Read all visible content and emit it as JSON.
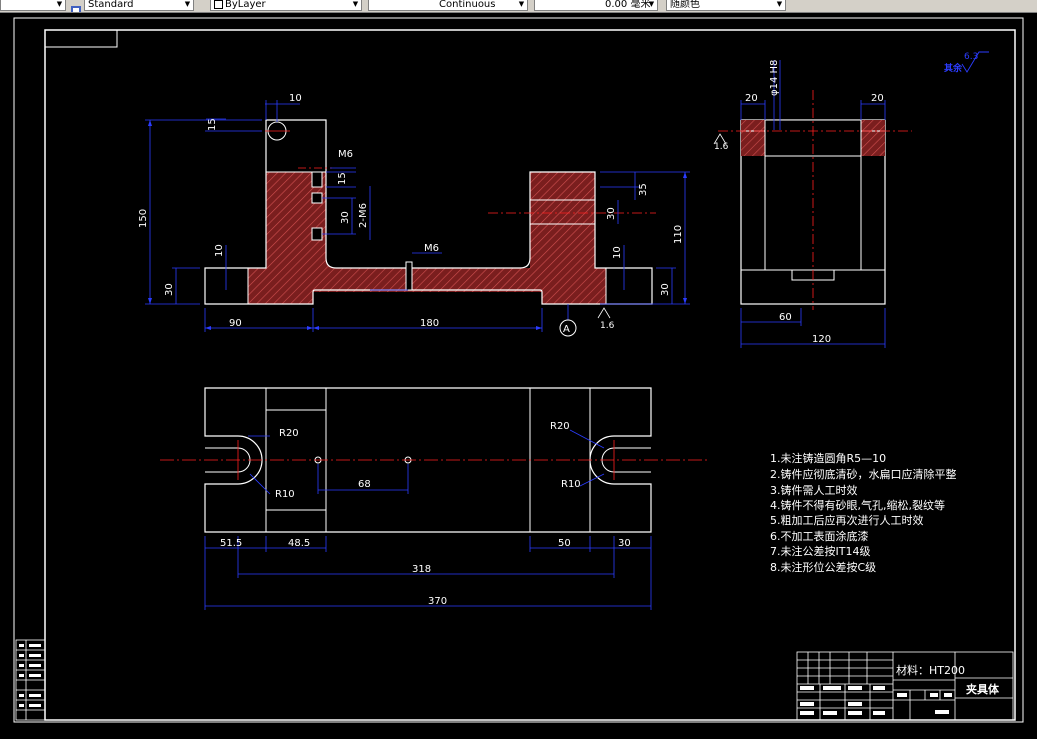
{
  "toolbar": {
    "style_combo": "Standard",
    "layer_combo": "ByLayer",
    "linetype_combo": "Continuous",
    "lineweight_combo": "0.00 毫米",
    "color_combo": "随颜色"
  },
  "front_view": {
    "dims": {
      "d10_top": "10",
      "d15": "15",
      "m6_side": "M6",
      "d15_small": "15",
      "d30": "30",
      "d2m6": "2-M6",
      "d150": "150",
      "d10_left": "10",
      "d30_left": "30",
      "d90": "90",
      "d180": "180",
      "m6_mid": "M6",
      "d35": "35",
      "d30_right_hole": "30",
      "d10_right": "10",
      "d110": "110",
      "d30_right": "30",
      "rough_front": "1.6"
    },
    "datum_label": "A"
  },
  "side_view": {
    "dims": {
      "d20_left": "20",
      "d20_right": "20",
      "bore": "φ14 H8",
      "d60": "60",
      "d120": "120",
      "rough_side": "1.6"
    }
  },
  "surface_finish": {
    "label": "其余",
    "value": "6.3"
  },
  "top_view": {
    "dims": {
      "r20_left": "R20",
      "r10_left": "R10",
      "d68": "68",
      "r20_right": "R20",
      "r10_right": "R10",
      "d51_5": "51.5",
      "d48_5": "48.5",
      "d50": "50",
      "d30": "30",
      "d318": "318",
      "d370": "370"
    }
  },
  "notes": [
    "1.未注铸造圆角R5—10",
    "2.铸件应彻底清砂，水扁口应清除平整",
    "3.铸件需人工时效",
    "4.铸件不得有砂眼,气孔,缩松,裂纹等",
    "5.粗加工后应再次进行人工时效",
    "6.不加工表面涂底漆",
    "7.未注公差按IT14级",
    "8.未注形位公差按C级"
  ],
  "title_block": {
    "material": "材料：HT200",
    "part_name": "夹具体"
  },
  "colors": {
    "outline": "#ffffff",
    "dimension": "#2b3cff",
    "centerline": "#ff2020",
    "hatch": "#a83030",
    "note_text": "#ffffff"
  }
}
